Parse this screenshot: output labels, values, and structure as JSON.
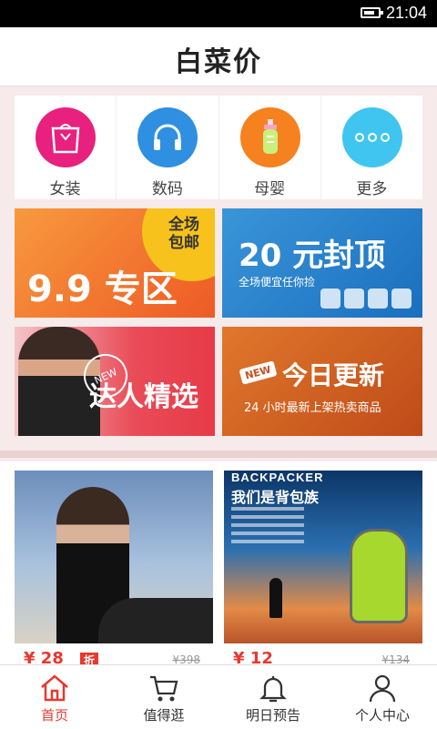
{
  "status_bar": {
    "time": "21:04",
    "battery_level": 0.8
  },
  "header": {
    "title": "白菜价"
  },
  "categories": [
    {
      "label": "女装",
      "icon": "shopping-bag-icon",
      "color": "#e8207e"
    },
    {
      "label": "数码",
      "icon": "headphones-icon",
      "color": "#2f8fe0"
    },
    {
      "label": "母婴",
      "icon": "baby-bottle-icon",
      "color": "#f5811f"
    },
    {
      "label": "更多",
      "icon": "more-dots-icon",
      "color": "#3fc5ef"
    }
  ],
  "banners": {
    "b1": {
      "corner_text": "全场包邮",
      "headline": "9.9 专区"
    },
    "b2": {
      "headline": "20 元封顶",
      "subtitle": "全场便宜任你捡"
    },
    "b3": {
      "badge": "NEW",
      "headline": "达人精选"
    },
    "b4": {
      "badge": "NEW",
      "headline": "今日更新",
      "subtitle": "24 小时最新上架热卖商品"
    }
  },
  "products": [
    {
      "price": "¥ 28",
      "tag": "折",
      "original_price": "¥398"
    },
    {
      "brand": "BACKPACKER",
      "headline": "我们是背包族",
      "price": "¥ 12",
      "original_price": "¥134"
    }
  ],
  "tabbar": {
    "tabs": [
      {
        "label": "首页",
        "icon": "home-icon",
        "active": true
      },
      {
        "label": "值得逛",
        "icon": "cart-icon",
        "active": false
      },
      {
        "label": "明日预告",
        "icon": "bell-icon",
        "active": false
      },
      {
        "label": "个人中心",
        "icon": "person-icon",
        "active": false
      }
    ],
    "active_color": "#e8382f"
  }
}
